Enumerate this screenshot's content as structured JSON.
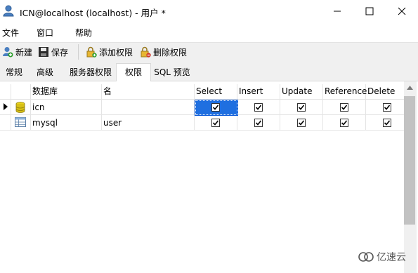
{
  "window": {
    "title": "ICN@localhost (localhost) - 用户 *"
  },
  "menu": {
    "items": [
      "文件",
      "窗口",
      "帮助"
    ]
  },
  "toolbar": {
    "new_label": "新建",
    "save_label": "保存",
    "add_priv_label": "添加权限",
    "del_priv_label": "删除权限"
  },
  "tabs": [
    {
      "label": "常规",
      "active": false
    },
    {
      "label": "高级",
      "active": false
    },
    {
      "label": "服务器权限",
      "active": false
    },
    {
      "label": "权限",
      "active": true
    },
    {
      "label": "SQL 预览",
      "active": false
    }
  ],
  "grid": {
    "columns": [
      "数据库",
      "名",
      "Select",
      "Insert",
      "Update",
      "Reference",
      "Delete"
    ],
    "rows": [
      {
        "database": "icn",
        "name": "",
        "select": true,
        "insert": true,
        "update": true,
        "reference": true,
        "delete": true,
        "current": true,
        "type_icon": "database-icon"
      },
      {
        "database": "mysql",
        "name": "user",
        "select": true,
        "insert": true,
        "update": true,
        "reference": true,
        "delete": true,
        "current": false,
        "type_icon": "table-icon"
      }
    ]
  },
  "watermark": {
    "text": "亿速云"
  },
  "colors": {
    "accent": "#1f6fe0",
    "toolbar_bg": "#f0f0f0"
  }
}
